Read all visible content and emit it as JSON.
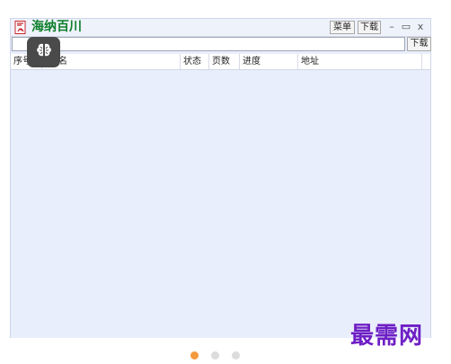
{
  "titlebar": {
    "app_title": "海纳百川",
    "menu_label": "菜单",
    "download_label": "下载",
    "minimize_glyph": "–",
    "maximize_glyph": "▭",
    "close_glyph": "x",
    "app_icon": "pdf-doc-icon"
  },
  "toolbar": {
    "url_value": "",
    "download_label": "下载"
  },
  "table": {
    "columns": [
      "序号",
      "名",
      "状态",
      "页数",
      "进度",
      "地址"
    ],
    "rows": []
  },
  "overlay": {
    "icon": "brain-icon"
  },
  "watermark": {
    "text": "最需网"
  },
  "pager": {
    "total": 3,
    "active": 1
  },
  "colors": {
    "title_green": "#0d7f2a",
    "body_bg": "#e9eefc",
    "watermark_purple": "#6e1fc4",
    "active_dot": "#f59a3c"
  }
}
